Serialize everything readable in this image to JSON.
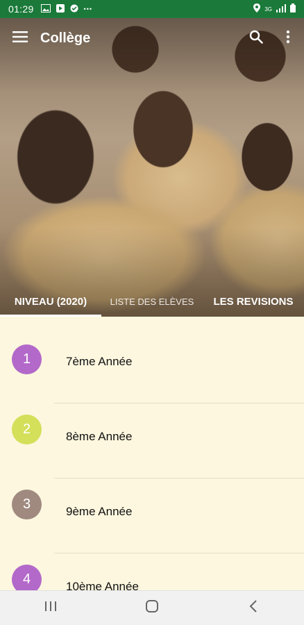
{
  "status_bar": {
    "time": "01:29",
    "left_icons": [
      "image-icon",
      "play-store-icon",
      "vpn-icon"
    ],
    "overflow": "•••",
    "right_icons": [
      "location-icon",
      "signal-icon",
      "battery-icon"
    ],
    "network": "3G"
  },
  "toolbar": {
    "title": "Collège",
    "menu_icon": "menu-icon",
    "search_icon": "search-icon",
    "more_icon": "more-vert-icon"
  },
  "tabs": [
    {
      "label": "NIVEAU (2020)",
      "active": true
    },
    {
      "label": "LISTE DES ELÈVES",
      "active": false
    },
    {
      "label": "LES REVISIONS",
      "active": false
    }
  ],
  "levels": [
    {
      "number": "1",
      "label": "7ème Année",
      "color": "#b369c9"
    },
    {
      "number": "2",
      "label": "8ème Année",
      "color": "#d4df5a"
    },
    {
      "number": "3",
      "label": "9ème Année",
      "color": "#a08a80"
    },
    {
      "number": "4",
      "label": "10ème Année",
      "color": "#b369c9"
    }
  ],
  "colors": {
    "status_bar": "#1b7a3a",
    "list_background": "#fdf7df",
    "nav_bar": "#f1f1f1"
  },
  "nav_bar": {
    "recents_icon": "recents-icon",
    "home_icon": "home-icon",
    "back_icon": "back-icon"
  }
}
